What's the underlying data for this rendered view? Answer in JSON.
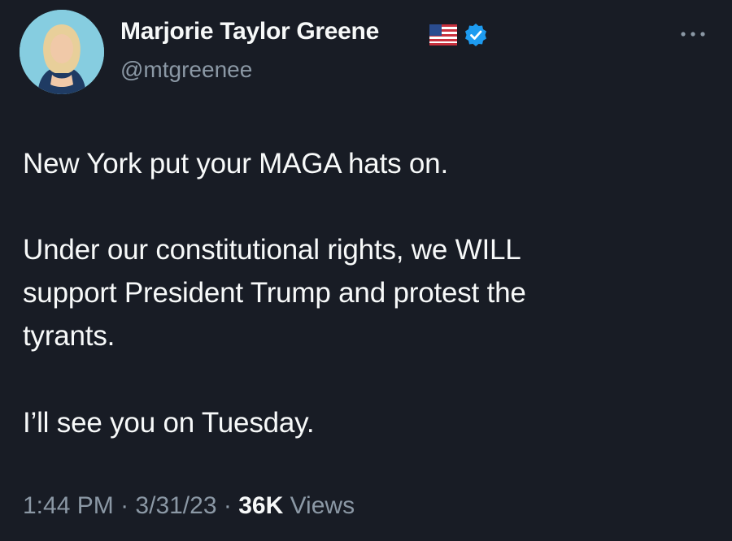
{
  "author": {
    "name": "Marjorie Taylor Greene",
    "handle": "@mtgreenee",
    "flag_icon": "us-flag-icon",
    "verified_icon": "verified-badge-icon",
    "verified_color": "#1d9bf0"
  },
  "tweet": {
    "paragraphs": [
      "New York put your MAGA hats on.",
      "Under our constitutional rights, we WILL\nsupport President Trump and protest the\ntyrants.",
      "I’ll see you on Tuesday."
    ]
  },
  "meta": {
    "time": "1:44 PM",
    "separator": "·",
    "date": "3/31/23",
    "views_count": "36K",
    "views_label": "Views"
  },
  "colors": {
    "background": "#181c25",
    "text_primary": "#f7f9f9",
    "text_secondary": "#8b98a5"
  }
}
